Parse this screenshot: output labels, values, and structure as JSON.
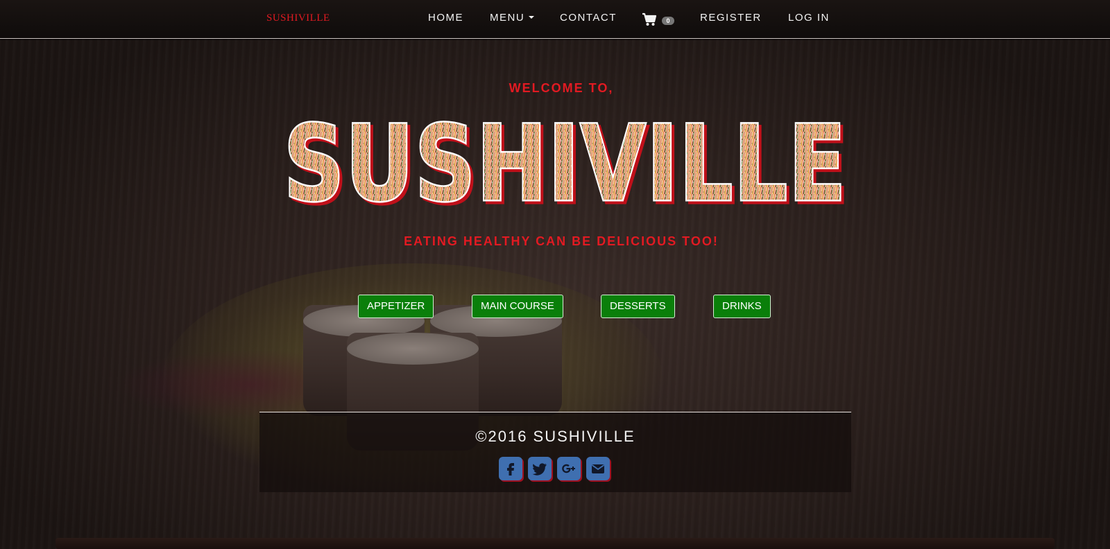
{
  "navbar": {
    "brand": "SUSHIVILLE",
    "links": {
      "home": "HOME",
      "menu": "MENU",
      "contact": "CONTACT",
      "register": "REGISTER",
      "login": "LOG IN"
    },
    "cart_count": "0"
  },
  "hero": {
    "welcome": "WELCOME TO,",
    "logo_text": "SUSHIVILLE",
    "tagline": "EATING HEALTHY CAN BE DELICIOUS TOO!"
  },
  "categories": {
    "appetizer": "APPETIZER",
    "main_course": "MAIN COURSE",
    "desserts": "DESSERTS",
    "drinks": "DRINKS"
  },
  "footer": {
    "copyright": "©2016 SUSHIVILLE",
    "social": [
      "facebook-icon",
      "twitter-icon",
      "google-plus-icon",
      "email-icon"
    ]
  },
  "colors": {
    "brand_red": "#e21a22",
    "button_green": "#0a7f0a",
    "social_blue": "#3f6fb0",
    "navbar_bg": "#120e0d"
  }
}
